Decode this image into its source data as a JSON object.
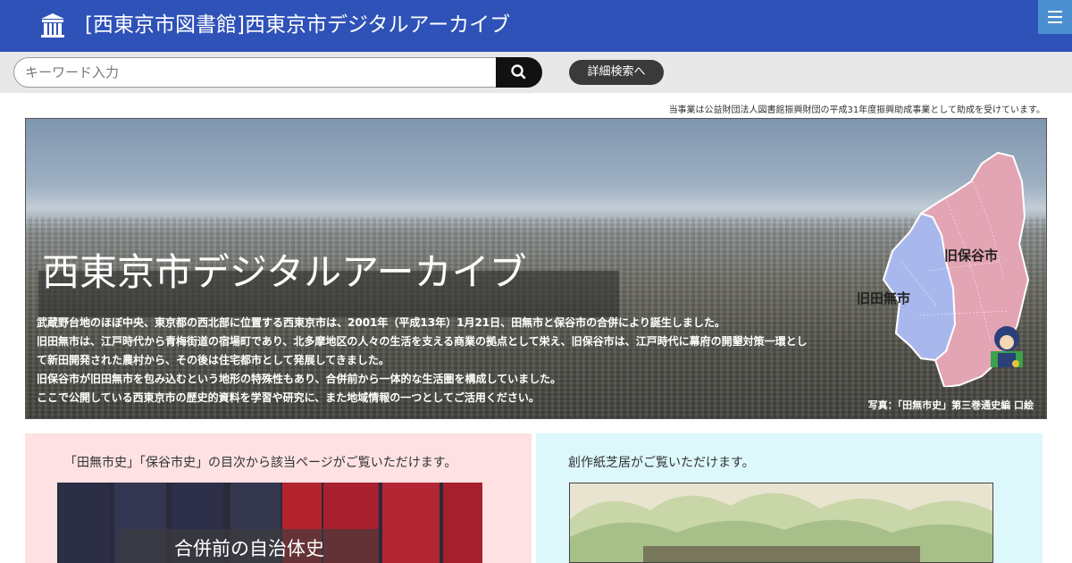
{
  "header": {
    "site_title": "[西東京市図書館]西東京市デジタルアーカイブ",
    "logo_icon": "library-building-icon",
    "menu_icon": "hamburger-menu-icon"
  },
  "search": {
    "placeholder": "キーワード入力",
    "value": "",
    "search_icon": "search-icon",
    "advanced_label": "詳細検索へ"
  },
  "grant_note": "当事業は公益財団法人図書館振興財団の平成31年度振興助成事業として助成を受けています。",
  "hero": {
    "title": "西東京市デジタルアーカイブ",
    "description": [
      "武蔵野台地のほぼ中央、東京都の西北部に位置する西東京市は、2001年（平成13年）1月21日、田無市と保谷市の合併により誕生しました。",
      "旧田無市は、江戸時代から青梅街道の宿場町であり、北多摩地区の人々の生活を支える商業の拠点として栄え、旧保谷市は、江戸時代に幕府の開墾対策一環として新田開発された農村から、その後は住宅都市として発展してきました。",
      "旧保谷市が旧田無市を包み込むという地形の特殊性もあり、合併前から一体的な生活圏を構成していました。",
      "ここで公開している西東京市の歴史的資料を学習や研究に、また地域情報の一つとしてご活用ください。"
    ],
    "map_labels": {
      "hoya": "旧保谷市",
      "tanashi": "旧田無市"
    },
    "photo_credit": "写真：「田無市史」第三巻通史編 口絵"
  },
  "panels": {
    "left_text": "「田無市史」「保谷市史」の目次から該当ページがご覧いただけます。",
    "left_caption": "合併前の自治体史",
    "right_text": "創作紙芝居がご覧いただけます。"
  },
  "colors": {
    "header_bg": "#2f52b8",
    "menu_bg": "#4b8fd0",
    "panel_left_bg": "#fde1e3",
    "panel_right_bg": "#dcf8fb",
    "map_hoya": "#e3a4b3",
    "map_tanashi": "#a9b8ec"
  }
}
